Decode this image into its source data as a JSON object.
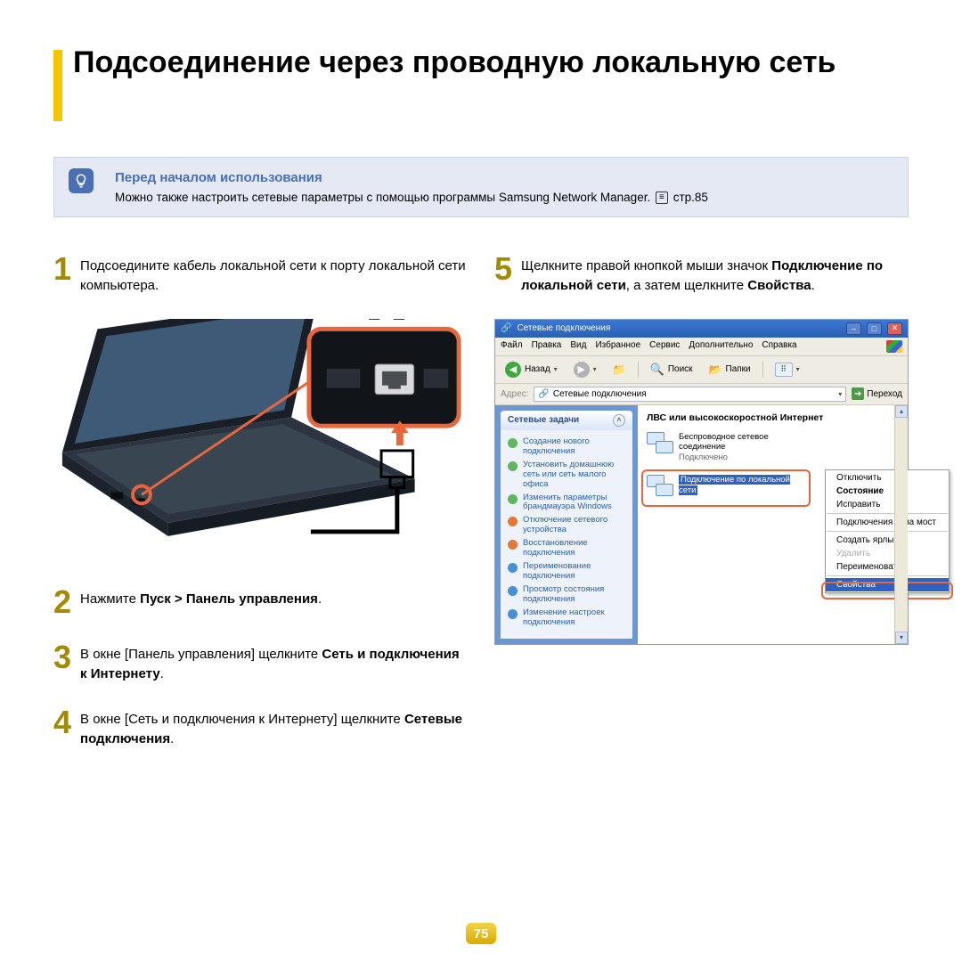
{
  "title": "Подсоединение через проводную локальную сеть",
  "tip": {
    "title": "Перед началом использования",
    "body_prefix": "Можно также настроить сетевые параметры с помощью программы Samsung Network Manager. ",
    "page_ref": "стр.85"
  },
  "steps": {
    "s1": {
      "num": "1",
      "text": "Подсоедините кабель локальной сети к порту локальной сети компьютера."
    },
    "s2": {
      "num": "2",
      "prefix": "Нажмите ",
      "bold": "Пуск > Панель управления",
      "suffix": "."
    },
    "s3": {
      "num": "3",
      "prefix": "В окне [Панель управления] щелкните ",
      "bold": "Сеть и подключения к Интернету",
      "suffix": "."
    },
    "s4": {
      "num": "4",
      "prefix": "В окне [Сеть и подключения к Интернету] щелкните ",
      "bold": "Сетевые подключения",
      "suffix": "."
    },
    "s5": {
      "num": "5",
      "prefix": "Щелкните правой кнопкой мыши значок ",
      "bold1": "Подключение по локальной сети",
      "mid": ", а затем щелкните ",
      "bold2": "Свойства",
      "suffix": "."
    }
  },
  "win": {
    "title": "Сетевые подключения",
    "menu": {
      "m1": "Файл",
      "m2": "Правка",
      "m3": "Вид",
      "m4": "Избранное",
      "m5": "Сервис",
      "m6": "Дополнительно",
      "m7": "Справка"
    },
    "toolbar": {
      "back": "Назад",
      "search": "Поиск",
      "folders": "Папки"
    },
    "address": {
      "label": "Адрес:",
      "value": "Сетевые подключения",
      "go": "Переход"
    },
    "side": {
      "header": "Сетевые задачи",
      "items": [
        "Создание нового подключения",
        "Установить домашнюю сеть или сеть малого офиса",
        "Изменить параметры брандмауэра Windows",
        "Отключение сетевого устройства",
        "Восстановление подключения",
        "Переименование подключения",
        "Просмотр состояния подключения",
        "Изменение настроек подключения"
      ]
    },
    "category": "ЛВС или высокоскоростной Интернет",
    "wifi": {
      "label": "Беспроводное сетевое соединение",
      "status": "Подключено"
    },
    "lan": {
      "label": "Подключение по локальной сети"
    },
    "ctx": {
      "i1": "Отключить",
      "i2": "Состояние",
      "i3": "Исправить",
      "i4": "Подключения типа мост",
      "i5": "Создать ярлык",
      "i6": "Удалить",
      "i7": "Переименовать",
      "i8": "Свойства"
    }
  },
  "page_number": "75"
}
